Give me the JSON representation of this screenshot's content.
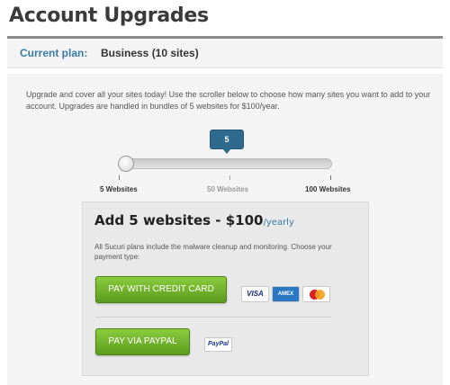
{
  "page": {
    "title": "Account Upgrades"
  },
  "plan": {
    "label": "Current plan:",
    "value": "Business (10 sites)"
  },
  "intro": {
    "text": "Upgrade and cover all your sites today! Use the scroller below to choose how many sites you want to add to your account. Upgrades are handled in bundles of 5 websites for $100/year."
  },
  "slider": {
    "current_value": "5",
    "labels": {
      "min": "5 Websites",
      "mid": "50 Websites",
      "max": "100 Websites"
    }
  },
  "upgrade": {
    "headline": "Add 5 websites - $100",
    "per": "/yearly",
    "description": "All Sucuri plans include the malware cleanup and monitoring. Choose your payment type:",
    "credit_card_button": "PAY WITH CREDIT CARD",
    "paypal_button": "PAY VIA PAYPAL",
    "cards": {
      "visa": "VISA",
      "amex": "AMEX",
      "paypal": "PayPal"
    }
  },
  "colors": {
    "accent_blue": "#3b7aa6",
    "bubble": "#2e6a8e",
    "button_green": "#6fb22c"
  }
}
